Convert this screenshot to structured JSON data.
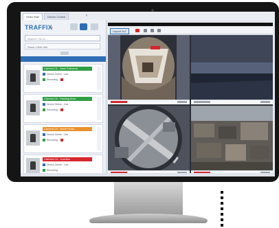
{
  "window": {
    "tabs": [
      {
        "label": "Video Wall"
      },
      {
        "label": "Device Control"
      }
    ],
    "close_glyph": "×"
  },
  "sidebar": {
    "logo_text": "TRAFFIX",
    "logo_mark": "®",
    "search_placeholder": "Search / Go to ...",
    "filter_label": "Show / Hide Info",
    "items": [
      {
        "title": "Camera 01 - Main Entrance",
        "title_color": "#2f9e44",
        "line1": "Device Online - Live",
        "line2": "Recording"
      },
      {
        "title": "Camera 02 - Parking Area",
        "title_color": "#2f9e44",
        "line1": "Device Online - Live",
        "line2": "Recording"
      },
      {
        "title": "Camera 03 - North Road",
        "title_color": "#e8912d",
        "line1": "Device Online - Live",
        "line2": "Recording"
      },
      {
        "title": "Camera 04 - Junction",
        "title_color": "#d7262e",
        "line1": "Device Online - Live",
        "line2": "Recording"
      }
    ]
  },
  "viewer": {
    "layout_label": "Layout 2x2"
  },
  "colors": {
    "accent": "#2f6fb6",
    "alert": "#d7262e",
    "ok": "#2f9e44",
    "warn": "#e8912d"
  }
}
